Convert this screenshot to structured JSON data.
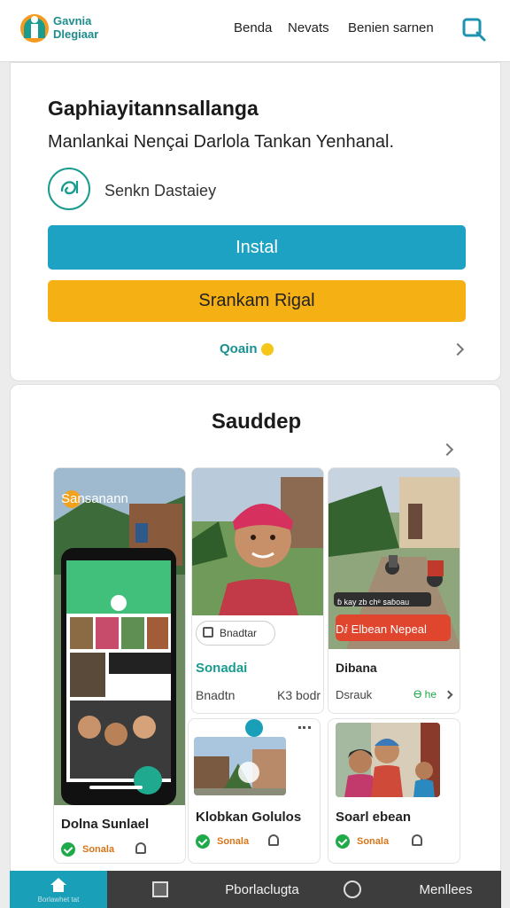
{
  "header": {
    "logo_line1": "Gavnia",
    "logo_line2": "Dlegiaar",
    "nav": [
      "Benda",
      "Nevats",
      "Benien sarnen"
    ]
  },
  "app": {
    "title": "Gaphiayitannsallanga",
    "subtitle": "Manlankai Nençai Darlola Tankan Yenhanal.",
    "developer": "Senkn Dastaiey",
    "install_label": "Instal",
    "secondary_label": "Srankam Rigal",
    "more_label": "Qoain"
  },
  "screenshots": {
    "title": "Sauddep",
    "items": [
      {
        "overlay": "Sansanann",
        "name": "Dolna Sunlael",
        "status": "Sonala"
      },
      {
        "chip": "Bnadtar",
        "name": "Sonadai",
        "sub": "Bnadtn",
        "sub_right": "K3 bodr"
      },
      {
        "badge": "Dⅈ Elbean Nepeal",
        "caption": "ɓ kay zb chᵉ ꜱaɓoau",
        "name": "Dibana",
        "sub": "Dsrauk",
        "sub_right": "Ɵ he"
      },
      {
        "name": "Klobkan Golulos",
        "status": "Sonala"
      },
      {
        "name": "Soarl ebean",
        "status": "Sonala"
      }
    ]
  },
  "bottom_nav": [
    "Borlawhet tat",
    "Pborlaclugta",
    "Menllees"
  ],
  "colors": {
    "install": "#1ea2c4",
    "secondary": "#f5b014",
    "accent": "#1a9b8f",
    "app_green": "#3fc17a",
    "badge_red": "#e0452e",
    "bottom_bar": "#3d3d3d",
    "bottom_active": "#1a9fb8"
  },
  "icons": [
    "app-logo-icon",
    "search-icon",
    "developer-icon",
    "chevron-right-icon",
    "check-icon",
    "bell-icon",
    "home-icon",
    "tablet-icon",
    "compass-icon"
  ]
}
